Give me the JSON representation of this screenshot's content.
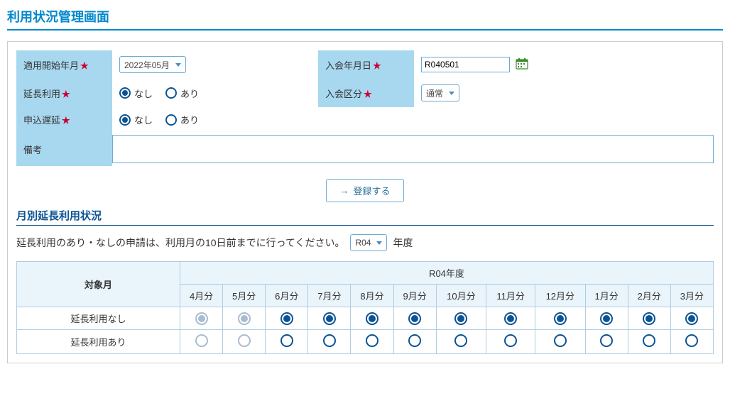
{
  "page_title": "利用状況管理画面",
  "form": {
    "start_ym_label": "適用開始年月",
    "start_ym_value": "2022年05月",
    "join_date_label": "入会年月日",
    "join_date_value": "R040501",
    "extension_label": "延長利用",
    "extension_options": {
      "none": "なし",
      "yes": "あり"
    },
    "extension_selected": "none",
    "join_type_label": "入会区分",
    "join_type_value": "通常",
    "delay_label": "申込遅延",
    "delay_options": {
      "none": "なし",
      "yes": "あり"
    },
    "delay_selected": "none",
    "note_label": "備考",
    "note_value": "",
    "register_button": "登録する"
  },
  "monthly": {
    "section_title": "月別延長利用状況",
    "instruction": "延長利用のあり・なしの申請は、利用月の10日前までに行ってください。",
    "year_value": "R04",
    "year_suffix": "年度",
    "fiscal_header": "R04年度",
    "target_month_label": "対象月",
    "months": [
      "4月分",
      "5月分",
      "6月分",
      "7月分",
      "8月分",
      "9月分",
      "10月分",
      "11月分",
      "12月分",
      "1月分",
      "2月分",
      "3月分"
    ],
    "row_none_label": "延長利用なし",
    "row_yes_label": "延長利用あり",
    "disabled_months": [
      true,
      true,
      false,
      false,
      false,
      false,
      false,
      false,
      false,
      false,
      false,
      false
    ],
    "selected": [
      "none",
      "none",
      "none",
      "none",
      "none",
      "none",
      "none",
      "none",
      "none",
      "none",
      "none",
      "none"
    ]
  }
}
